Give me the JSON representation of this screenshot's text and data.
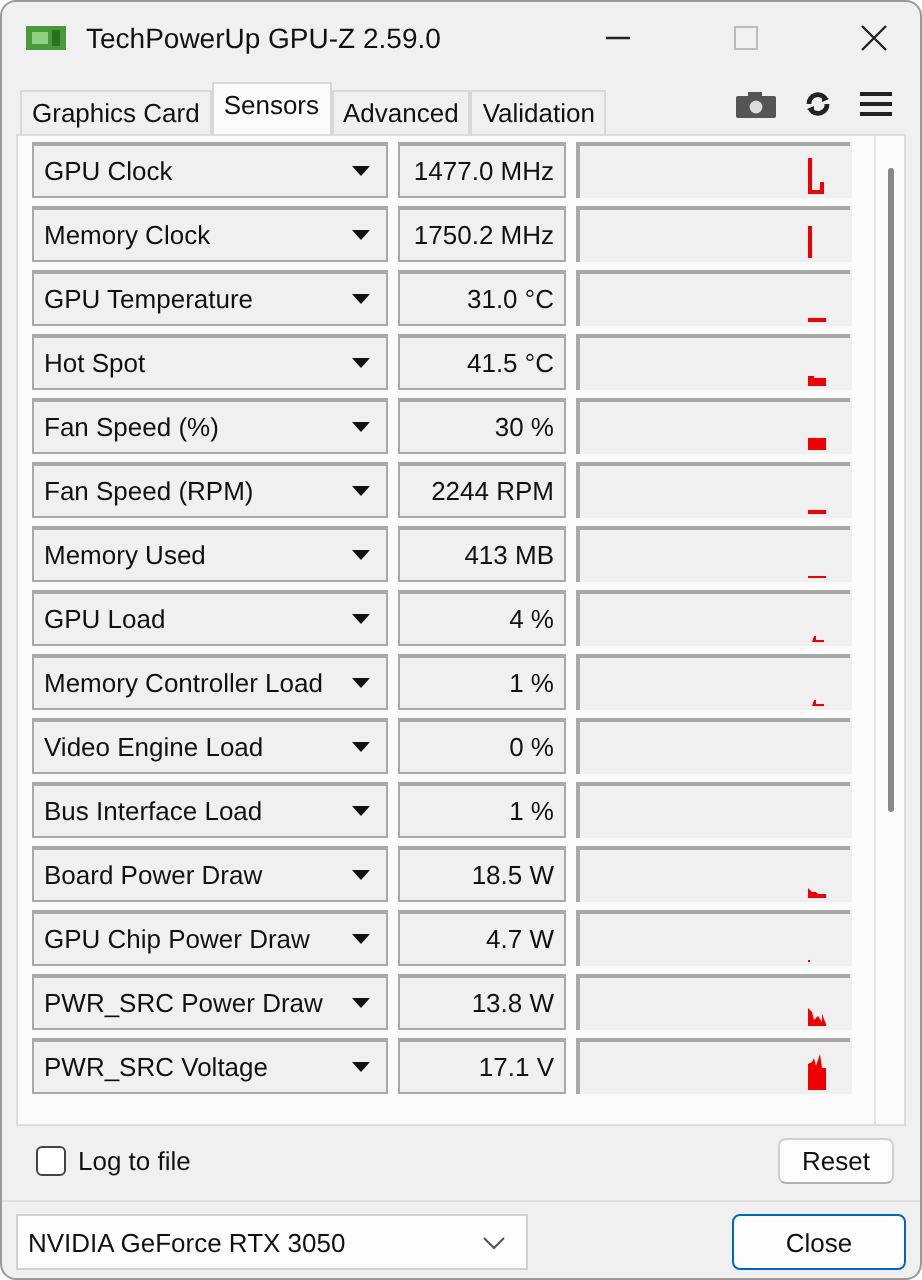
{
  "window": {
    "title": "TechPowerUp GPU-Z 2.59.0"
  },
  "tabs": [
    {
      "label": "Graphics Card",
      "selected": false
    },
    {
      "label": "Sensors",
      "selected": true
    },
    {
      "label": "Advanced",
      "selected": false
    },
    {
      "label": "Validation",
      "selected": false
    }
  ],
  "sensors": [
    {
      "name": "GPU Clock",
      "value": "1477.0 MHz"
    },
    {
      "name": "Memory Clock",
      "value": "1750.2 MHz"
    },
    {
      "name": "GPU Temperature",
      "value": "31.0 °C"
    },
    {
      "name": "Hot Spot",
      "value": "41.5 °C"
    },
    {
      "name": "Fan Speed (%)",
      "value": "30 %"
    },
    {
      "name": "Fan Speed (RPM)",
      "value": "2244 RPM"
    },
    {
      "name": "Memory Used",
      "value": "413 MB"
    },
    {
      "name": "GPU Load",
      "value": "4 %"
    },
    {
      "name": "Memory Controller Load",
      "value": "1 %"
    },
    {
      "name": "Video Engine Load",
      "value": "0 %"
    },
    {
      "name": "Bus Interface Load",
      "value": "1 %"
    },
    {
      "name": "Board Power Draw",
      "value": "18.5 W"
    },
    {
      "name": "GPU Chip Power Draw",
      "value": "4.7 W"
    },
    {
      "name": "PWR_SRC Power Draw",
      "value": "13.8 W"
    },
    {
      "name": "PWR_SRC Voltage",
      "value": "17.1 V"
    }
  ],
  "log_to_file": {
    "label": "Log to file",
    "checked": false
  },
  "reset_button": "Reset",
  "device_select": {
    "value": "NVIDIA GeForce RTX 3050"
  },
  "close_button": "Close"
}
